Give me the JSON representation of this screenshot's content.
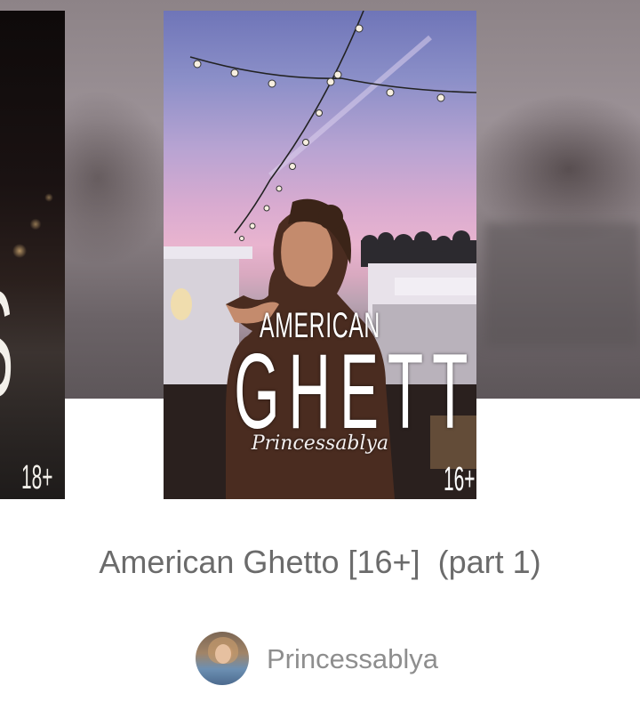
{
  "carousel": {
    "left_cover": {
      "big_text": "S",
      "age_rating": "18+"
    },
    "main_cover": {
      "title_line1": "AMERICAN",
      "title_line2": "GHETTO",
      "author_script": "Princessablya",
      "age_rating": "16+"
    }
  },
  "story": {
    "title": "American Ghetto [16+]  (part 1)"
  },
  "author": {
    "name": "Princessablya",
    "avatar_icon": "user-avatar"
  },
  "colors": {
    "title_text": "#6b6b6b",
    "author_text": "#8e8e8e",
    "background": "#ffffff"
  }
}
